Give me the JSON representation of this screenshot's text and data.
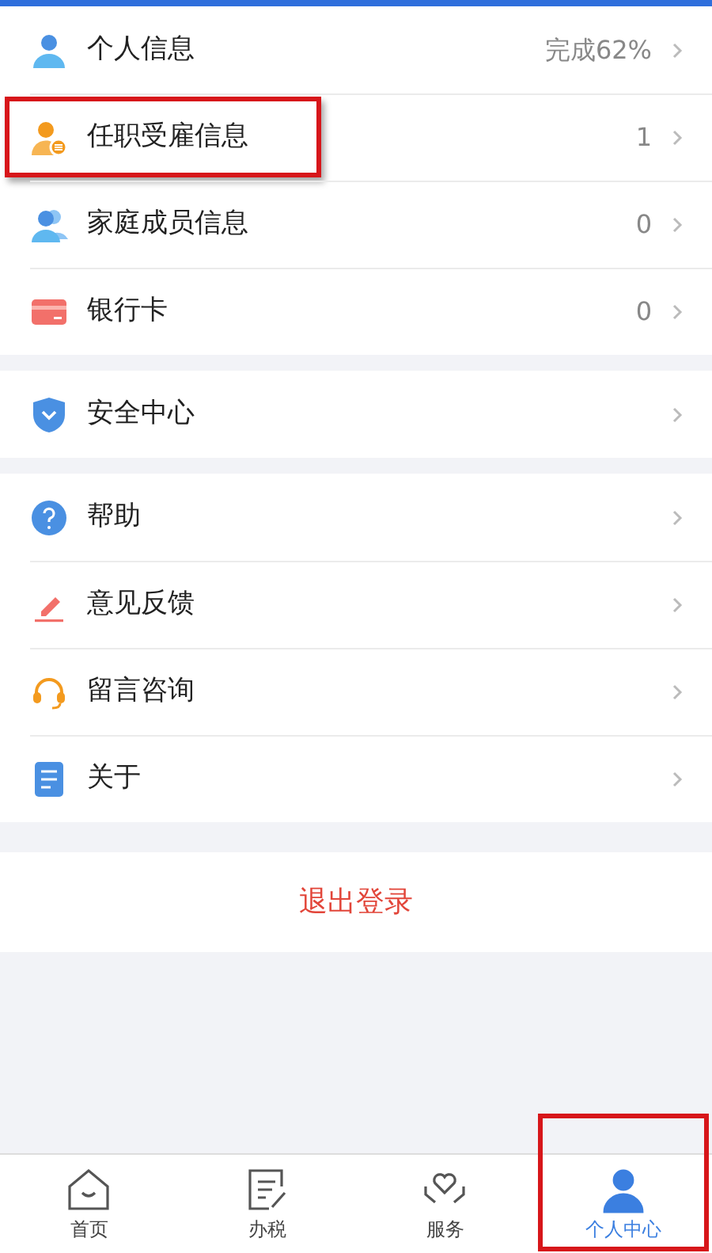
{
  "groups": [
    {
      "items": [
        {
          "label": "个人信息",
          "value": "完成62%",
          "highlighted": false
        },
        {
          "label": "任职受雇信息",
          "value": "1",
          "highlighted": true
        },
        {
          "label": "家庭成员信息",
          "value": "0",
          "highlighted": false
        },
        {
          "label": "银行卡",
          "value": "0",
          "highlighted": false
        }
      ]
    },
    {
      "items": [
        {
          "label": "安全中心",
          "highlighted": false
        }
      ]
    },
    {
      "items": [
        {
          "label": "帮助",
          "highlighted": false
        },
        {
          "label": "意见反馈",
          "highlighted": false
        },
        {
          "label": "留言咨询",
          "highlighted": false
        },
        {
          "label": "关于",
          "highlighted": false
        }
      ]
    }
  ],
  "logout": "退出登录",
  "tabs": [
    {
      "label": "首页",
      "selected": false,
      "highlighted": false
    },
    {
      "label": "办税",
      "selected": false,
      "highlighted": false
    },
    {
      "label": "服务",
      "selected": false,
      "highlighted": false
    },
    {
      "label": "个人中心",
      "selected": true,
      "highlighted": true
    }
  ]
}
